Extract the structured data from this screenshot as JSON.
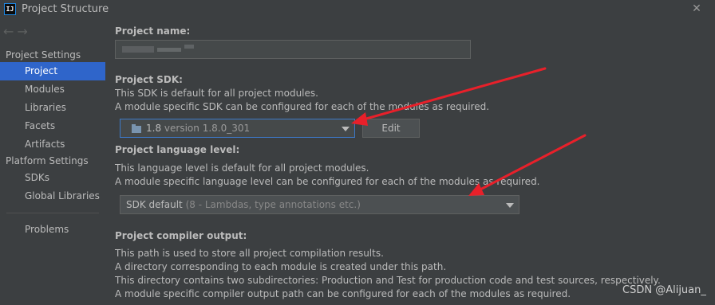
{
  "window": {
    "title": "Project Structure",
    "app_icon_text": "IJ"
  },
  "sidebar": {
    "nav_back": "←",
    "nav_forward": "→",
    "groups": [
      {
        "header": "Project Settings",
        "items": [
          "Project",
          "Modules",
          "Libraries",
          "Facets",
          "Artifacts"
        ]
      },
      {
        "header": "Platform Settings",
        "items": [
          "SDKs",
          "Global Libraries"
        ]
      }
    ],
    "extra_item": "Problems",
    "selected": "Project"
  },
  "main": {
    "project_name": {
      "label": "Project name:",
      "value": ""
    },
    "project_sdk": {
      "label": "Project SDK:",
      "desc1": "This SDK is default for all project modules.",
      "desc2": "A module specific SDK can be configured for each of the modules as required.",
      "selected_version": "1.8",
      "selected_detail": "version 1.8.0_301",
      "edit_label": "Edit"
    },
    "language_level": {
      "label": "Project language level:",
      "desc1": "This language level is default for all project modules.",
      "desc2": "A module specific language level can be configured for each of the modules as required.",
      "selected_value": "SDK default",
      "selected_hint": "(8 - Lambdas, type annotations etc.)"
    },
    "compiler_output": {
      "label": "Project compiler output:",
      "desc1": "This path is used to store all project compilation results.",
      "desc2": "A directory corresponding to each module is created under this path.",
      "desc3": "This directory contains two subdirectories: Production and Test for production code and test sources, respectively.",
      "desc4": "A module specific compiler output path can be configured for each of the modules as required."
    }
  },
  "watermark": "CSDN @Alijuan_",
  "colors": {
    "background": "#3c3f41",
    "selection": "#2f65ca",
    "annotation_arrow": "#e8202a",
    "focus_border": "#3d79c8"
  }
}
